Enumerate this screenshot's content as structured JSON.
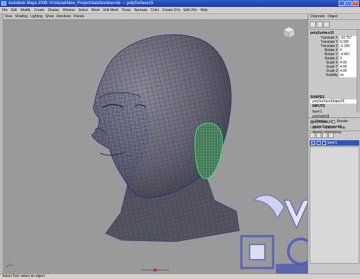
{
  "window": {
    "title": "Autodesk Maya 2008: H:\\niuzai\\New_Project\\data\\tou\\low.mb  ---  polySurface15"
  },
  "menubar": {
    "items": [
      "File",
      "Edit",
      "Modify",
      "Create",
      "Display",
      "Window",
      "Select",
      "Mesh",
      "Edit Mesh",
      "Proxy",
      "Normals",
      "Color",
      "Create UVs",
      "Edit UVs",
      "Help"
    ]
  },
  "panel": {
    "menu": [
      "View",
      "Shading",
      "Lighting",
      "Show",
      "Renderer",
      "Panels"
    ]
  },
  "channel_box": {
    "tabs": [
      "Channels",
      "Object"
    ],
    "object_name": "polySurface15",
    "attributes": [
      {
        "name": "Translate X",
        "value": "-32.757"
      },
      {
        "name": "Translate Y",
        "value": "6.396"
      },
      {
        "name": "Translate Z",
        "value": "-2.336"
      },
      {
        "name": "Rotate X",
        "value": "0"
      },
      {
        "name": "Rotate Y",
        "value": "-4.467"
      },
      {
        "name": "Rotate Z",
        "value": "0"
      },
      {
        "name": "Scale X",
        "value": "4.99"
      },
      {
        "name": "Scale Y",
        "value": "4.99"
      },
      {
        "name": "Scale Z",
        "value": "4.99"
      },
      {
        "name": "Visibility",
        "value": "on"
      }
    ],
    "shapes_header": "SHAPES",
    "shape": "polySurfaceShape15",
    "inputs_header": "INPUTS",
    "inputs": [
      "layer1",
      "polySplit18",
      "polyTweak21",
      "deleteComponent7",
      "deleteComponent6"
    ]
  },
  "layer_editor": {
    "display_label": "Display",
    "render_label": "Render",
    "menu": [
      "Layers",
      "Options",
      "Help"
    ],
    "layer_v": "V",
    "layer_name": "layer1"
  },
  "status": {
    "text": "Select Tool: select an object"
  },
  "colors": {
    "viewport_bg": "#9a9a9a",
    "mesh_fill": "#6a6a70",
    "wire": "#1e2a80",
    "selected_wire": "#3cff8a",
    "title_blue": "#1a3c9c"
  }
}
